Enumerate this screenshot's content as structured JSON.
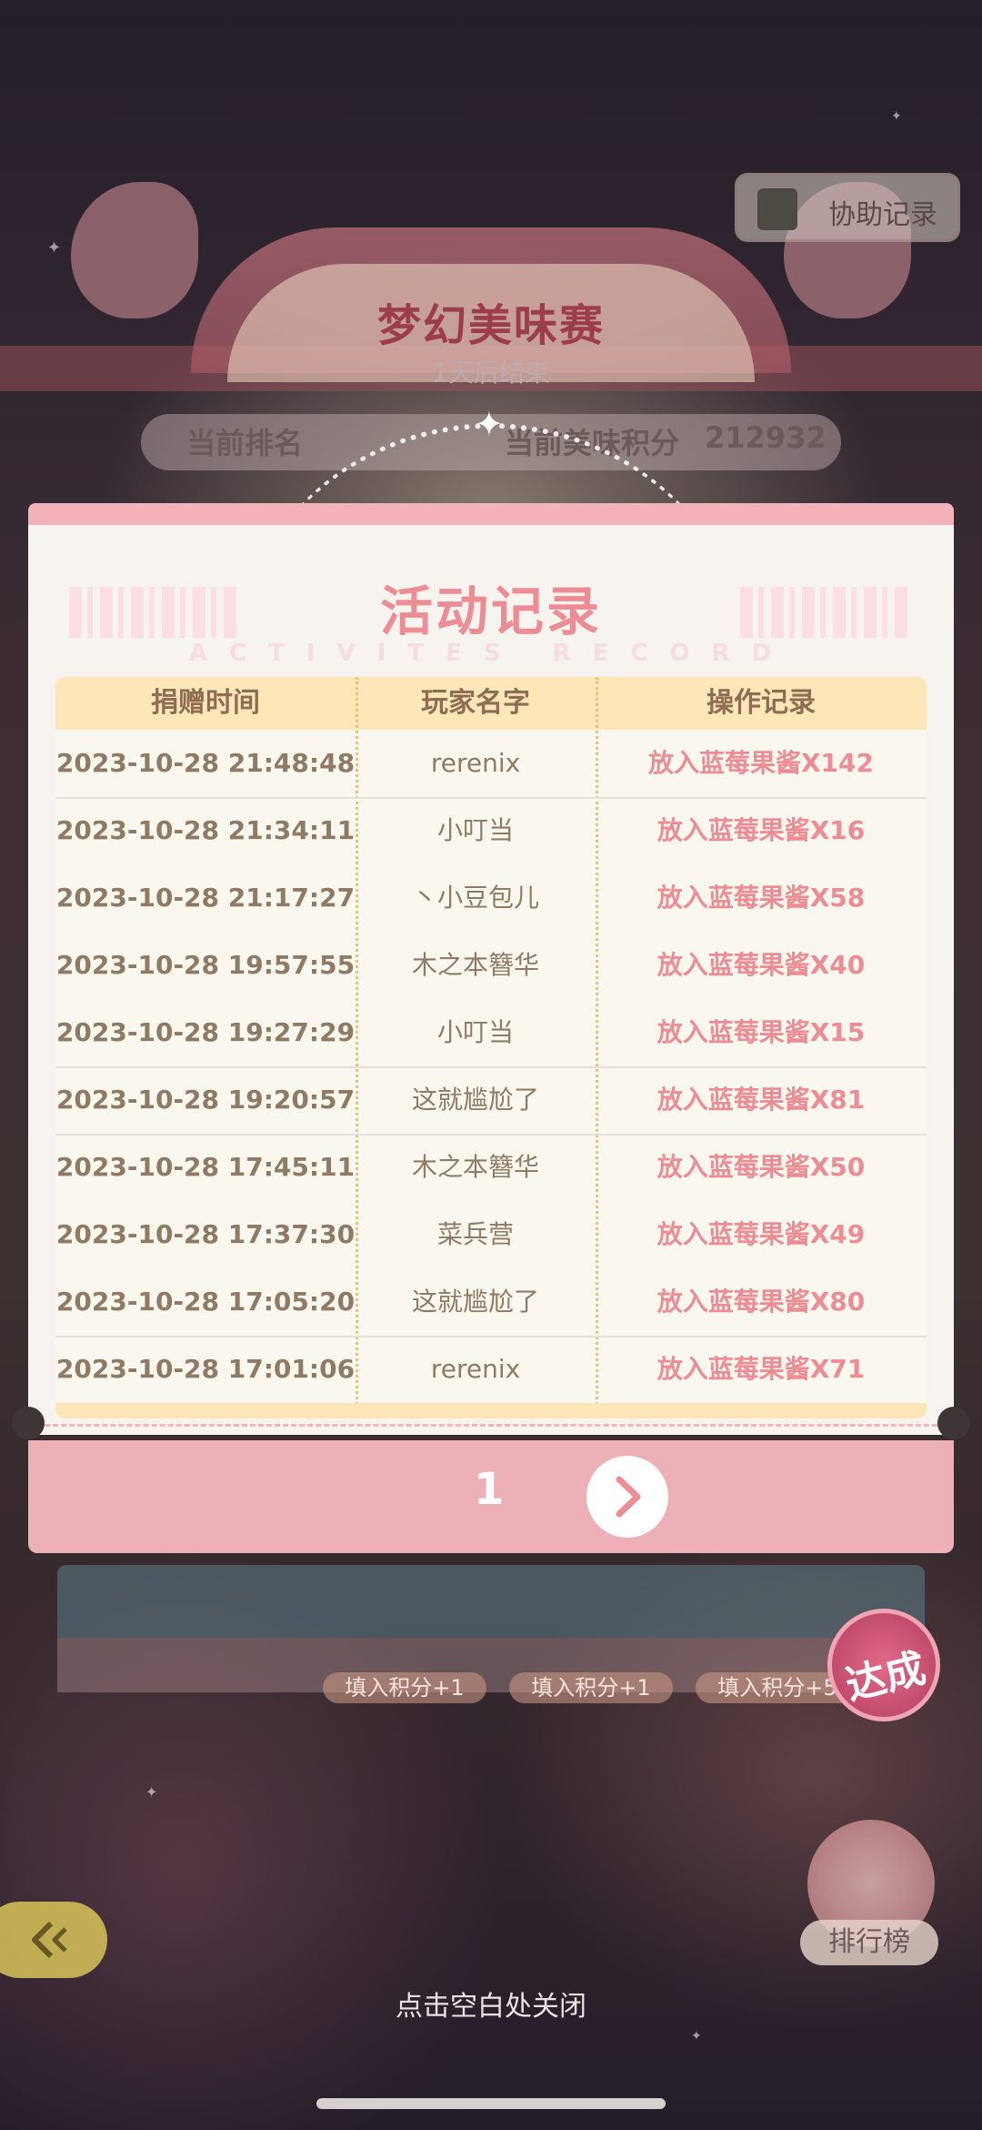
{
  "background": {
    "event_title": "梦幻美味赛",
    "event_subtitle": "1天后结束",
    "rank_label": "当前排名",
    "score_label": "当前美味积分",
    "score_value": "212932",
    "assist_record": "协助记录",
    "pill_labels": [
      "填入积分+1",
      "填入积分+1",
      "填入积分+5"
    ],
    "badge": "达成",
    "leaderboard": "排行榜",
    "close_hint": "点击空白处关闭"
  },
  "modal": {
    "title": "活动记录",
    "subtitle": "ACTIVITES RECORD",
    "columns": [
      "捐赠时间",
      "玩家名字",
      "操作记录"
    ],
    "rows": [
      {
        "time": "2023-10-28 21:48:48",
        "player": "rerenix",
        "action": "放入蓝莓果酱X142"
      },
      {
        "time": "2023-10-28 21:34:11",
        "player": "小叮当",
        "action": "放入蓝莓果酱X16"
      },
      {
        "time": "2023-10-28 21:17:27",
        "player": "丶小豆包儿",
        "action": "放入蓝莓果酱X58"
      },
      {
        "time": "2023-10-28 19:57:55",
        "player": "木之本簪华",
        "action": "放入蓝莓果酱X40"
      },
      {
        "time": "2023-10-28 19:27:29",
        "player": "小叮当",
        "action": "放入蓝莓果酱X15"
      },
      {
        "time": "2023-10-28 19:20:57",
        "player": "这就尴尬了",
        "action": "放入蓝莓果酱X81"
      },
      {
        "time": "2023-10-28 17:45:11",
        "player": "木之本簪华",
        "action": "放入蓝莓果酱X50"
      },
      {
        "time": "2023-10-28 17:37:30",
        "player": "菜兵营",
        "action": "放入蓝莓果酱X49"
      },
      {
        "time": "2023-10-28 17:05:20",
        "player": "这就尴尬了",
        "action": "放入蓝莓果酱X80"
      },
      {
        "time": "2023-10-28 17:01:06",
        "player": "rerenix",
        "action": "放入蓝莓果酱X71"
      }
    ],
    "page": "1"
  },
  "colors": {
    "accent_pink": "#ec8d96",
    "header_yellow": "#fde7b8",
    "pager_pink": "#edb0b7"
  },
  "icons": [
    "notebook-icon",
    "chevron-right-icon",
    "back-arrow-icon",
    "cake-icon",
    "star-icon"
  ]
}
